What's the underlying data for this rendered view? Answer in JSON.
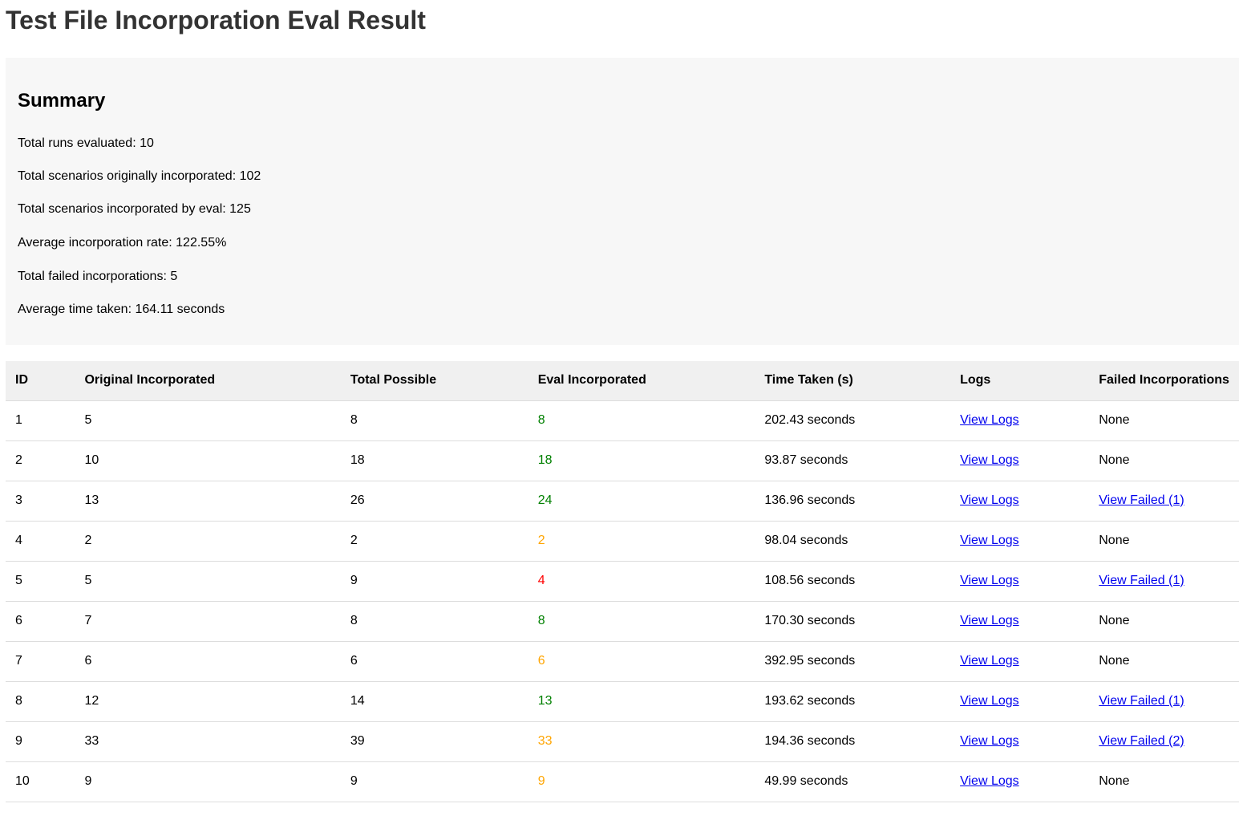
{
  "page": {
    "title": "Test File Incorporation Eval Result"
  },
  "summary": {
    "heading": "Summary",
    "lines": [
      "Total runs evaluated: 10",
      "Total scenarios originally incorporated: 102",
      "Total scenarios incorporated by eval: 125",
      "Average incorporation rate: 122.55%",
      "Total failed incorporations: 5",
      "Average time taken: 164.11 seconds"
    ]
  },
  "table": {
    "headers": [
      "ID",
      "Original Incorporated",
      "Total Possible",
      "Eval Incorporated",
      "Time Taken (s)",
      "Logs",
      "Failed Incorporations"
    ],
    "status_colors": {
      "green": "#008000",
      "orange": "#ffa500",
      "red": "#ff0000",
      "link": "#0000ee"
    },
    "rows": [
      {
        "id": "1",
        "original": "5",
        "possible": "8",
        "eval": "8",
        "eval_status": "green",
        "time": "202.43 seconds",
        "logs": "View Logs",
        "failed": "None",
        "failed_is_link": false
      },
      {
        "id": "2",
        "original": "10",
        "possible": "18",
        "eval": "18",
        "eval_status": "green",
        "time": "93.87 seconds",
        "logs": "View Logs",
        "failed": "None",
        "failed_is_link": false
      },
      {
        "id": "3",
        "original": "13",
        "possible": "26",
        "eval": "24",
        "eval_status": "green",
        "time": "136.96 seconds",
        "logs": "View Logs",
        "failed": "View Failed (1)",
        "failed_is_link": true
      },
      {
        "id": "4",
        "original": "2",
        "possible": "2",
        "eval": "2",
        "eval_status": "orange",
        "time": "98.04 seconds",
        "logs": "View Logs",
        "failed": "None",
        "failed_is_link": false
      },
      {
        "id": "5",
        "original": "5",
        "possible": "9",
        "eval": "4",
        "eval_status": "red",
        "time": "108.56 seconds",
        "logs": "View Logs",
        "failed": "View Failed (1)",
        "failed_is_link": true
      },
      {
        "id": "6",
        "original": "7",
        "possible": "8",
        "eval": "8",
        "eval_status": "green",
        "time": "170.30 seconds",
        "logs": "View Logs",
        "failed": "None",
        "failed_is_link": false
      },
      {
        "id": "7",
        "original": "6",
        "possible": "6",
        "eval": "6",
        "eval_status": "orange",
        "time": "392.95 seconds",
        "logs": "View Logs",
        "failed": "None",
        "failed_is_link": false
      },
      {
        "id": "8",
        "original": "12",
        "possible": "14",
        "eval": "13",
        "eval_status": "green",
        "time": "193.62 seconds",
        "logs": "View Logs",
        "failed": "View Failed (1)",
        "failed_is_link": true
      },
      {
        "id": "9",
        "original": "33",
        "possible": "39",
        "eval": "33",
        "eval_status": "orange",
        "time": "194.36 seconds",
        "logs": "View Logs",
        "failed": "View Failed (2)",
        "failed_is_link": true
      },
      {
        "id": "10",
        "original": "9",
        "possible": "9",
        "eval": "9",
        "eval_status": "orange",
        "time": "49.99 seconds",
        "logs": "View Logs",
        "failed": "None",
        "failed_is_link": false
      }
    ]
  }
}
